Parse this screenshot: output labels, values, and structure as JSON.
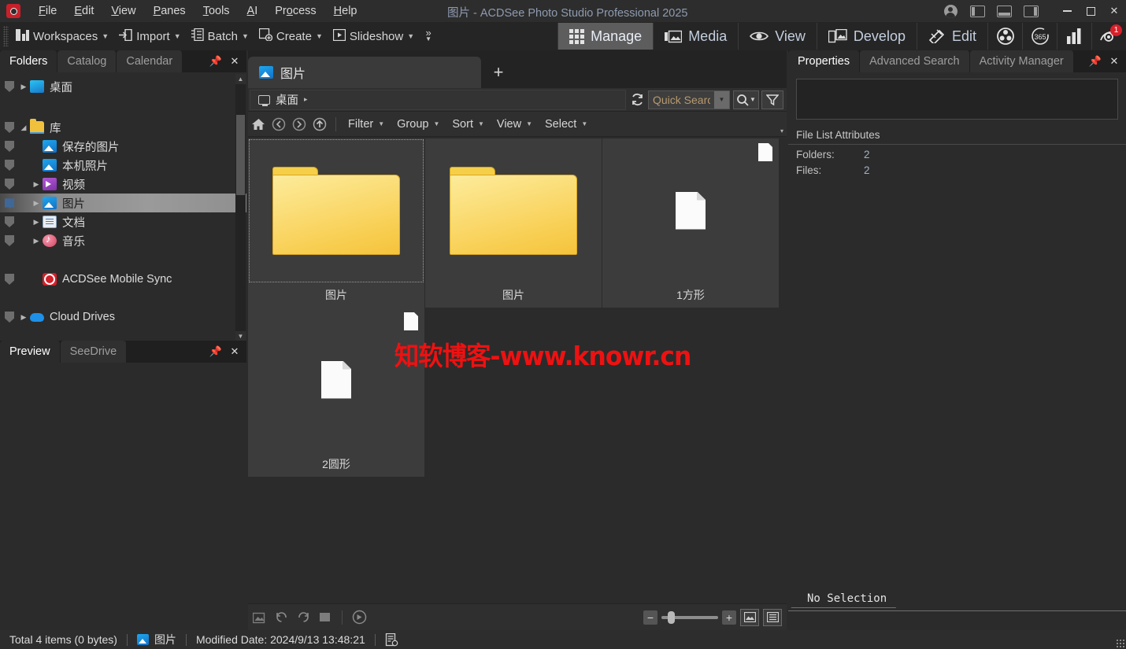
{
  "titlebar": {
    "app_icon": "acdsee-logo-icon",
    "window_title": "图片 - ACDSee Photo Studio Professional 2025",
    "menus": [
      {
        "label": "File",
        "accel": "F"
      },
      {
        "label": "Edit",
        "accel": "E"
      },
      {
        "label": "View",
        "accel": "V"
      },
      {
        "label": "Panes",
        "accel": "P"
      },
      {
        "label": "Tools",
        "accel": "T"
      },
      {
        "label": "AI",
        "accel": "A"
      },
      {
        "label": "Process",
        "accel": "o"
      },
      {
        "label": "Help",
        "accel": "H"
      }
    ],
    "account_icon": "user-account-icon",
    "layout_buttons": [
      "panel-left-icon",
      "panel-bottom-icon",
      "panel-right-icon"
    ],
    "minimize": "−",
    "maximize": "□",
    "close": "✕"
  },
  "toolbar": {
    "items": [
      {
        "label": "Workspaces",
        "icon": "workspaces-icon"
      },
      {
        "label": "Import",
        "icon": "import-icon"
      },
      {
        "label": "Batch",
        "icon": "batch-icon"
      },
      {
        "label": "Create",
        "icon": "create-icon"
      },
      {
        "label": "Slideshow",
        "icon": "slideshow-icon"
      }
    ],
    "overflow": "»"
  },
  "modes": [
    {
      "label": "Manage",
      "icon": "grid-icon",
      "active": true
    },
    {
      "label": "Media",
      "icon": "media-icon",
      "active": false
    },
    {
      "label": "View",
      "icon": "eye-icon",
      "active": false
    },
    {
      "label": "Develop",
      "icon": "develop-icon",
      "active": false
    },
    {
      "label": "Edit",
      "icon": "edit-brush-icon",
      "active": false
    }
  ],
  "mode_icons": [
    {
      "name": "color-wheel-icon"
    },
    {
      "name": "acdsee-365-icon",
      "label": "365"
    },
    {
      "name": "chart-bars-icon"
    },
    {
      "name": "camera-notify-icon",
      "badge": "1"
    }
  ],
  "sidebar": {
    "tabs": [
      {
        "label": "Folders",
        "active": true
      },
      {
        "label": "Catalog",
        "active": false
      },
      {
        "label": "Calendar",
        "active": false
      }
    ],
    "pin_icon": "pin-icon",
    "close_icon": "close-icon",
    "tree": [
      {
        "label": "桌面",
        "icon": "desktop-icon",
        "indent": 0,
        "expander": "right",
        "selected": false,
        "checked": false
      },
      {
        "label": "库",
        "icon": "library-folder-icon",
        "indent": 0,
        "expander": "down",
        "selected": false,
        "checked": false
      },
      {
        "label": "保存的图片",
        "icon": "pictures-icon",
        "indent": 1,
        "expander": "none",
        "selected": false,
        "checked": false
      },
      {
        "label": "本机照片",
        "icon": "pictures-icon",
        "indent": 1,
        "expander": "none",
        "selected": false,
        "checked": false
      },
      {
        "label": "视频",
        "icon": "video-icon",
        "indent": 1,
        "expander": "right",
        "selected": false,
        "checked": false
      },
      {
        "label": "图片",
        "icon": "pictures-icon",
        "indent": 1,
        "expander": "right",
        "selected": true,
        "checked": true
      },
      {
        "label": "文档",
        "icon": "documents-icon",
        "indent": 1,
        "expander": "right",
        "selected": false,
        "checked": false
      },
      {
        "label": "音乐",
        "icon": "music-icon",
        "indent": 1,
        "expander": "right",
        "selected": false,
        "checked": false
      },
      {
        "label": "ACDSee Mobile Sync",
        "icon": "mobile-sync-icon",
        "indent": 1,
        "expander": "none",
        "selected": false,
        "checked": false
      },
      {
        "label": "Cloud Drives",
        "icon": "cloud-drive-icon",
        "indent": 0,
        "expander": "right",
        "selected": false,
        "checked": false
      }
    ]
  },
  "preview_pane": {
    "tabs": [
      {
        "label": "Preview",
        "active": true
      },
      {
        "label": "SeeDrive",
        "active": false
      }
    ],
    "pin_icon": "pin-icon",
    "close_icon": "close-icon"
  },
  "main": {
    "file_tab": {
      "label": "图片",
      "icon": "pictures-icon"
    },
    "new_tab_label": "+",
    "breadcrumb": {
      "icon": "monitor-icon",
      "path": "桌面",
      "arrow": "▸"
    },
    "refresh_icon": "refresh-icon",
    "search": {
      "placeholder": "Quick Search",
      "value": "",
      "dropdown_icon": "chevron-down-icon",
      "search_icon": "search-icon",
      "filter_icon": "filter-icon"
    },
    "nav_icons": [
      "home-icon",
      "back-icon",
      "forward-icon",
      "up-icon"
    ],
    "menus": [
      "Filter",
      "Group",
      "Sort",
      "View",
      "Select"
    ],
    "overflow_caret": "▾",
    "items": [
      {
        "label": "图片",
        "type": "folder"
      },
      {
        "label": "图片",
        "type": "folder"
      },
      {
        "label": "1方形",
        "type": "document"
      },
      {
        "label": "2圆形",
        "type": "document"
      }
    ],
    "watermark": "知软博客-www.knowr.cn",
    "watermark_color": "#ee1111",
    "bottom_tools": [
      "image-delete-icon",
      "rotate-left-icon",
      "rotate-right-icon",
      "stop-icon",
      "slideshow-play-icon"
    ],
    "zoom": {
      "minus": "−",
      "plus": "+",
      "value": 12
    },
    "view_buttons": [
      "thumbnail-view-icon",
      "list-view-icon"
    ]
  },
  "rightpanel": {
    "tabs": [
      {
        "label": "Properties",
        "active": true
      },
      {
        "label": "Advanced Search",
        "active": false
      },
      {
        "label": "Activity Manager",
        "active": false
      }
    ],
    "pin_icon": "pin-icon",
    "close_icon": "close-icon",
    "section_title": "File List Attributes",
    "attributes": [
      {
        "key": "Folders:",
        "value": "2"
      },
      {
        "key": "Files:",
        "value": "2"
      }
    ],
    "selection_status": "No Selection"
  },
  "statusbar": {
    "total": "Total 4 items  (0 bytes)",
    "folder_icon": "pictures-icon",
    "folder_name": "图片",
    "modified": "Modified Date: 2024/9/13 13:48:21",
    "properties_icon": "file-properties-icon"
  }
}
